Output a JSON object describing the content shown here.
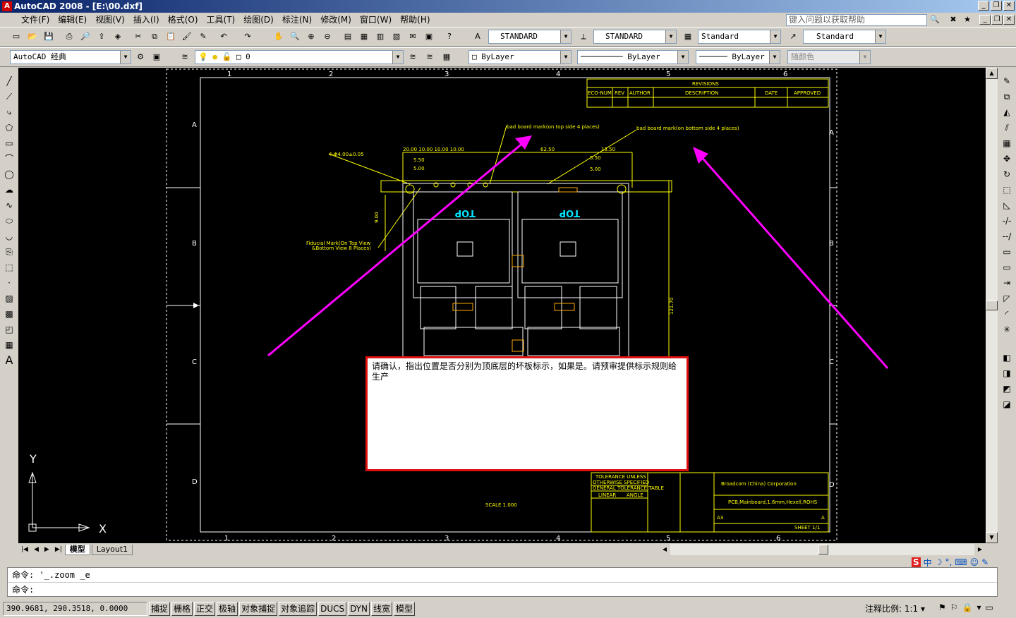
{
  "window": {
    "title": "AutoCAD 2008 - [E:\\00.dxf]"
  },
  "menus": [
    "文件(F)",
    "编辑(E)",
    "视图(V)",
    "插入(I)",
    "格式(O)",
    "工具(T)",
    "绘图(D)",
    "标注(N)",
    "修改(M)",
    "窗口(W)",
    "帮助(H)"
  ],
  "help_placeholder": "键入问题以获取帮助",
  "styles": {
    "text_style": "STANDARD",
    "dim_style": "STANDARD",
    "table_style": "Standard",
    "mleader_style": "Standard"
  },
  "workspace": "AutoCAD 经典",
  "layer": "0",
  "properties": {
    "color": "ByLayer",
    "linetype": "ByLayer",
    "lineweight": "ByLayer",
    "plotstyle": "随颜色"
  },
  "drawing": {
    "revisions_title": "REVISIONS",
    "rev_headers": [
      "ECO-NUM",
      "REV",
      "AUTHOR",
      "DESCRIPTION",
      "DATE",
      "APPROVED"
    ],
    "note_top": "bad board mark(on top side 4 places)",
    "note_bottom": "bad board mark(on bottom side 4 places)",
    "note_hole": "4-Φ4.00±0.05",
    "fiducial_1": "Fiducial Mark(On Top View",
    "fiducial_2": "&Bottom View 8 Places)",
    "top_label": "TOP",
    "dim_62": "62.50",
    "dim_550": "5.50",
    "dim_500": "5.00",
    "dim_1000": "20.00  10.00  10.00  10.00",
    "dim_13": "13.50",
    "dim_12170": "121.70",
    "dim_900": "9.00",
    "scale": "SCALE  1.000",
    "company": "Broadcom (China) Corporation",
    "title_desc": "PCB,Mainboard,1.6mm,Hexell,ROHS",
    "sheet_size": "A3",
    "tolerance_1": "TOLERANCE UNLESS",
    "tolerance_2": "OTHERWISE SPECIFIED",
    "gen_tol": "GENERAL TOLERANCE TABLE",
    "linear": "LINEAR",
    "angle": "ANGLE",
    "sheet": "SHEET 1/1",
    "rev": "A",
    "cols": [
      "1",
      "2",
      "3",
      "4",
      "5",
      "6"
    ],
    "rows": [
      "A",
      "B",
      "C",
      "D"
    ]
  },
  "comment_text": "请确认，指出位置是否分别为顶底层的坏板标示，如果是。请预审提供标示规则给生产",
  "ucs": {
    "x": "X",
    "y": "Y"
  },
  "tabs": {
    "model": "模型",
    "layout1": "Layout1"
  },
  "command": {
    "prev": "命令: '_.zoom _e",
    "prompt": "命令:"
  },
  "status": {
    "coords": "390.9681, 290.3518, 0.0000",
    "buttons": [
      "捕捉",
      "栅格",
      "正交",
      "极轴",
      "对象捕捉",
      "对象追踪",
      "DUCS",
      "DYN",
      "线宽",
      "模型"
    ],
    "annotation": "注释比例: 1:1 ▾"
  },
  "colors": {
    "annotation_arrow": "#ff00ff",
    "comment_border": "#e01010",
    "drawing_line": "#ffff00"
  }
}
